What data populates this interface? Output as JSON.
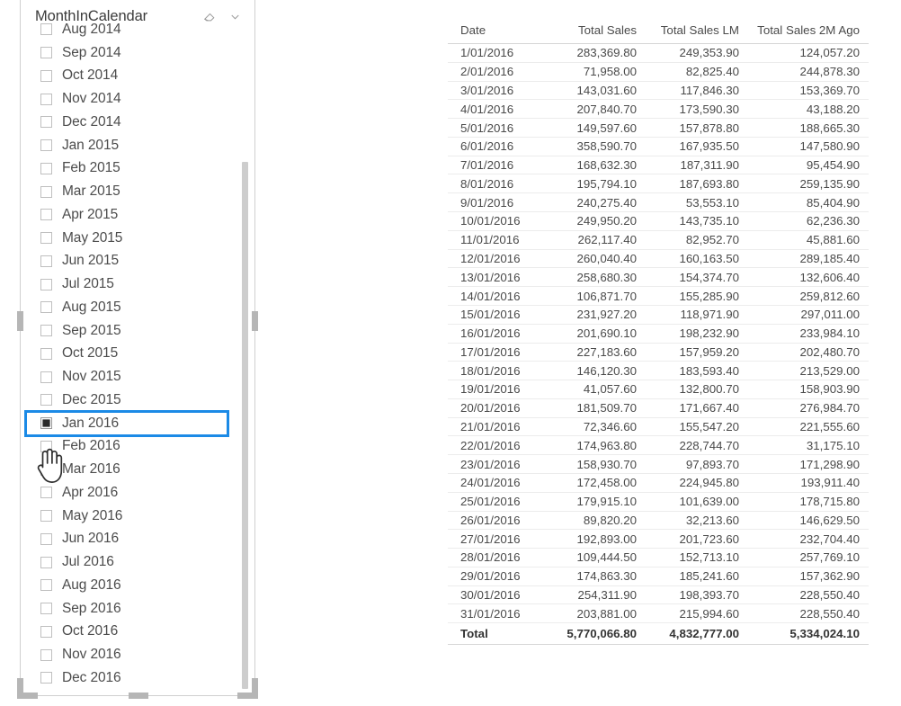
{
  "slicer": {
    "title": "MonthInCalendar",
    "icons": {
      "clear_filter": "eraser-icon",
      "expand": "chevron-down-icon"
    },
    "items": [
      {
        "label": "Aug 2014",
        "checked": false,
        "focused": false
      },
      {
        "label": "Sep 2014",
        "checked": false,
        "focused": false
      },
      {
        "label": "Oct 2014",
        "checked": false,
        "focused": false
      },
      {
        "label": "Nov 2014",
        "checked": false,
        "focused": false
      },
      {
        "label": "Dec 2014",
        "checked": false,
        "focused": false
      },
      {
        "label": "Jan 2015",
        "checked": false,
        "focused": false
      },
      {
        "label": "Feb 2015",
        "checked": false,
        "focused": false
      },
      {
        "label": "Mar 2015",
        "checked": false,
        "focused": false
      },
      {
        "label": "Apr 2015",
        "checked": false,
        "focused": false
      },
      {
        "label": "May 2015",
        "checked": false,
        "focused": false
      },
      {
        "label": "Jun 2015",
        "checked": false,
        "focused": false
      },
      {
        "label": "Jul 2015",
        "checked": false,
        "focused": false
      },
      {
        "label": "Aug 2015",
        "checked": false,
        "focused": false
      },
      {
        "label": "Sep 2015",
        "checked": false,
        "focused": false
      },
      {
        "label": "Oct 2015",
        "checked": false,
        "focused": false
      },
      {
        "label": "Nov 2015",
        "checked": false,
        "focused": false
      },
      {
        "label": "Dec 2015",
        "checked": false,
        "focused": false
      },
      {
        "label": "Jan 2016",
        "checked": true,
        "focused": true
      },
      {
        "label": "Feb 2016",
        "checked": false,
        "focused": false
      },
      {
        "label": "Mar 2016",
        "checked": false,
        "focused": false
      },
      {
        "label": "Apr 2016",
        "checked": false,
        "focused": false
      },
      {
        "label": "May 2016",
        "checked": false,
        "focused": false
      },
      {
        "label": "Jun 2016",
        "checked": false,
        "focused": false
      },
      {
        "label": "Jul 2016",
        "checked": false,
        "focused": false
      },
      {
        "label": "Aug 2016",
        "checked": false,
        "focused": false
      },
      {
        "label": "Sep 2016",
        "checked": false,
        "focused": false
      },
      {
        "label": "Oct 2016",
        "checked": false,
        "focused": false
      },
      {
        "label": "Nov 2016",
        "checked": false,
        "focused": false
      },
      {
        "label": "Dec 2016",
        "checked": false,
        "focused": false
      }
    ],
    "focus_color": "#1b8ae6"
  },
  "table": {
    "columns": [
      "Date",
      "Total Sales",
      "Total Sales LM",
      "Total Sales 2M Ago"
    ],
    "rows": [
      [
        "1/01/2016",
        "283,369.80",
        "249,353.90",
        "124,057.20"
      ],
      [
        "2/01/2016",
        "71,958.00",
        "82,825.40",
        "244,878.30"
      ],
      [
        "3/01/2016",
        "143,031.60",
        "117,846.30",
        "153,369.70"
      ],
      [
        "4/01/2016",
        "207,840.70",
        "173,590.30",
        "43,188.20"
      ],
      [
        "5/01/2016",
        "149,597.60",
        "157,878.80",
        "188,665.30"
      ],
      [
        "6/01/2016",
        "358,590.70",
        "167,935.50",
        "147,580.90"
      ],
      [
        "7/01/2016",
        "168,632.30",
        "187,311.90",
        "95,454.90"
      ],
      [
        "8/01/2016",
        "195,794.10",
        "187,693.80",
        "259,135.90"
      ],
      [
        "9/01/2016",
        "240,275.40",
        "53,553.10",
        "85,404.90"
      ],
      [
        "10/01/2016",
        "249,950.20",
        "143,735.10",
        "62,236.30"
      ],
      [
        "11/01/2016",
        "262,117.40",
        "82,952.70",
        "45,881.60"
      ],
      [
        "12/01/2016",
        "260,040.40",
        "160,163.50",
        "289,185.40"
      ],
      [
        "13/01/2016",
        "258,680.30",
        "154,374.70",
        "132,606.40"
      ],
      [
        "14/01/2016",
        "106,871.70",
        "155,285.90",
        "259,812.60"
      ],
      [
        "15/01/2016",
        "231,927.20",
        "118,971.90",
        "297,011.00"
      ],
      [
        "16/01/2016",
        "201,690.10",
        "198,232.90",
        "233,984.10"
      ],
      [
        "17/01/2016",
        "227,183.60",
        "157,959.20",
        "202,480.70"
      ],
      [
        "18/01/2016",
        "146,120.30",
        "183,593.40",
        "213,529.00"
      ],
      [
        "19/01/2016",
        "41,057.60",
        "132,800.70",
        "158,903.90"
      ],
      [
        "20/01/2016",
        "181,509.70",
        "171,667.40",
        "276,984.70"
      ],
      [
        "21/01/2016",
        "72,346.60",
        "155,547.20",
        "221,555.60"
      ],
      [
        "22/01/2016",
        "174,963.80",
        "228,744.70",
        "31,175.10"
      ],
      [
        "23/01/2016",
        "158,930.70",
        "97,893.70",
        "171,298.90"
      ],
      [
        "24/01/2016",
        "172,458.00",
        "224,945.80",
        "193,911.40"
      ],
      [
        "25/01/2016",
        "179,915.10",
        "101,639.00",
        "178,715.80"
      ],
      [
        "26/01/2016",
        "89,820.20",
        "32,213.60",
        "146,629.50"
      ],
      [
        "27/01/2016",
        "192,893.00",
        "201,723.60",
        "232,704.40"
      ],
      [
        "28/01/2016",
        "109,444.50",
        "152,713.10",
        "257,769.10"
      ],
      [
        "29/01/2016",
        "174,863.30",
        "185,241.60",
        "157,362.90"
      ],
      [
        "30/01/2016",
        "254,311.90",
        "198,393.70",
        "228,550.40"
      ],
      [
        "31/01/2016",
        "203,881.00",
        "215,994.60",
        "228,550.40"
      ]
    ],
    "total_row": [
      "Total",
      "5,770,066.80",
      "4,832,777.00",
      "5,334,024.10"
    ]
  }
}
